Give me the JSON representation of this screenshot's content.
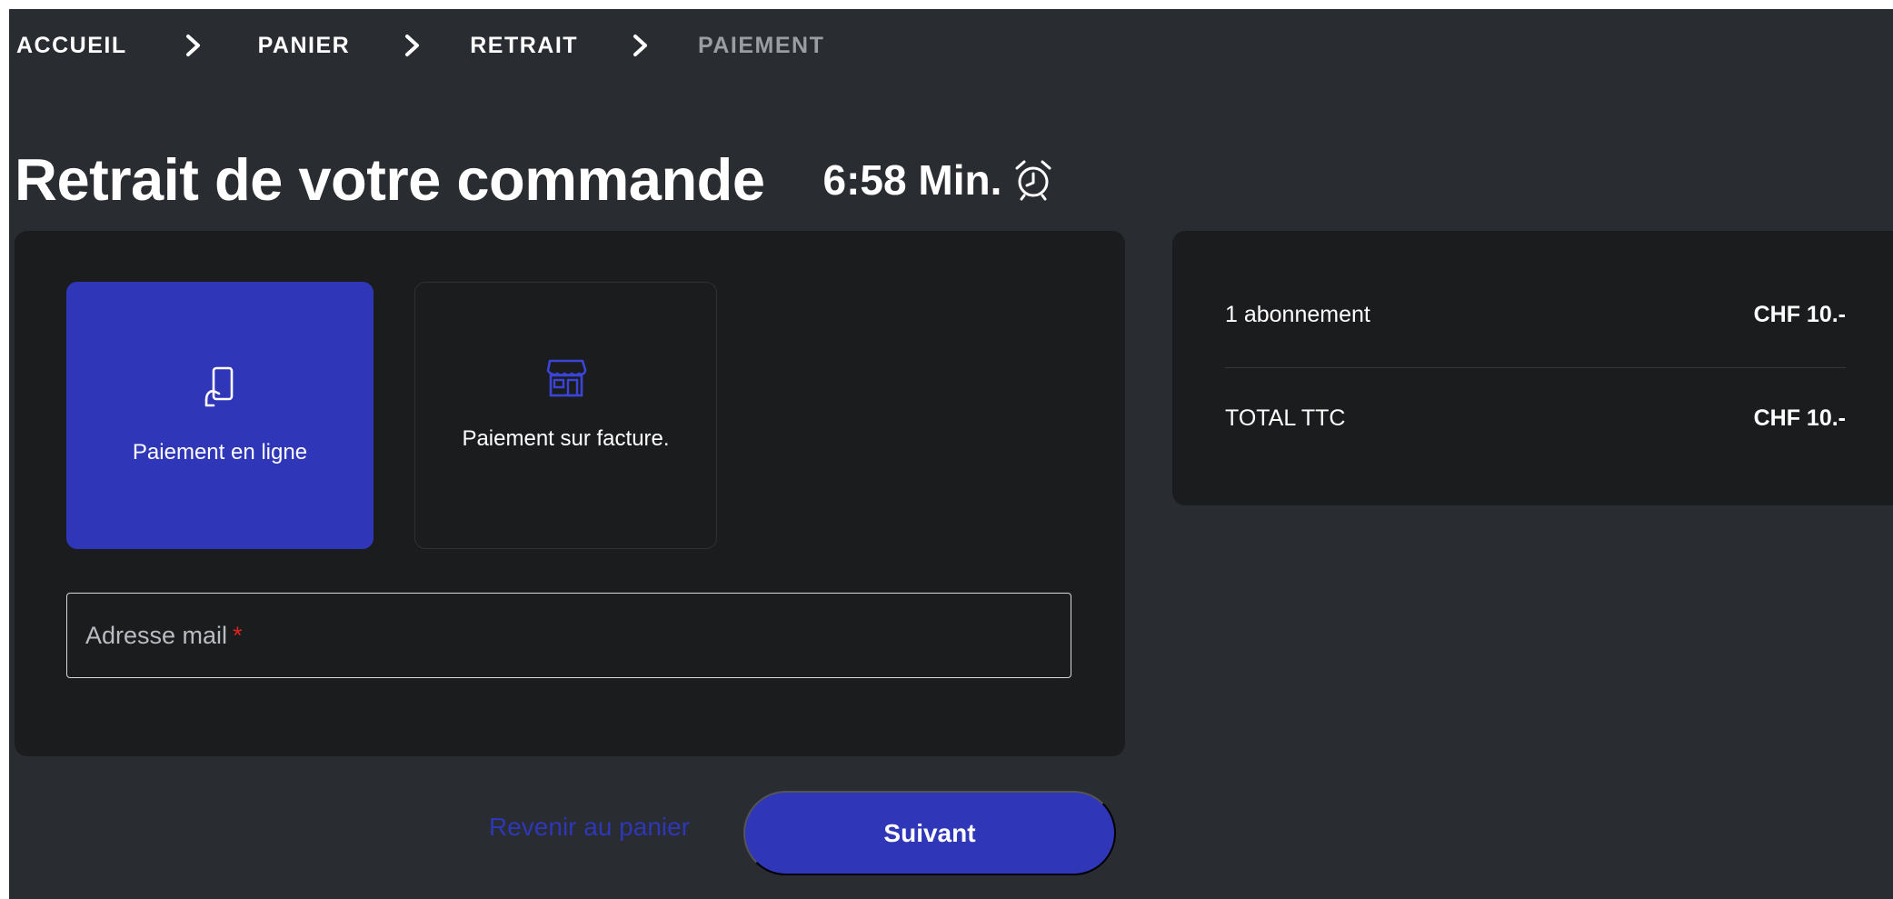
{
  "breadcrumb": {
    "items": [
      {
        "label": "ACCUEIL",
        "active": true
      },
      {
        "label": "PANIER",
        "active": true
      },
      {
        "label": "RETRAIT",
        "active": true
      },
      {
        "label": "PAIEMENT",
        "active": false
      }
    ],
    "separator_icon": "chevron-right-icon"
  },
  "header": {
    "title": "Retrait de votre commande",
    "timer": "6:58 Min.",
    "timer_icon": "alarm-clock-icon"
  },
  "payment_options": [
    {
      "label": "Paiement en ligne",
      "icon": "phone-payment-icon",
      "selected": true
    },
    {
      "label": "Paiement sur facture.",
      "icon": "store-icon",
      "selected": false
    }
  ],
  "email": {
    "label": "Adresse mail",
    "required_mark": "*"
  },
  "actions": {
    "back_label": "Revenir au panier",
    "next_label": "Suivant"
  },
  "summary": {
    "line_label": "1 abonnement",
    "line_amount": "CHF 10.-",
    "total_label": "TOTAL TTC",
    "total_amount": "CHF 10.-"
  },
  "colors": {
    "background": "#292c30",
    "card": "#1b1c1e",
    "accent": "#2f37b8",
    "required": "#e02424"
  }
}
